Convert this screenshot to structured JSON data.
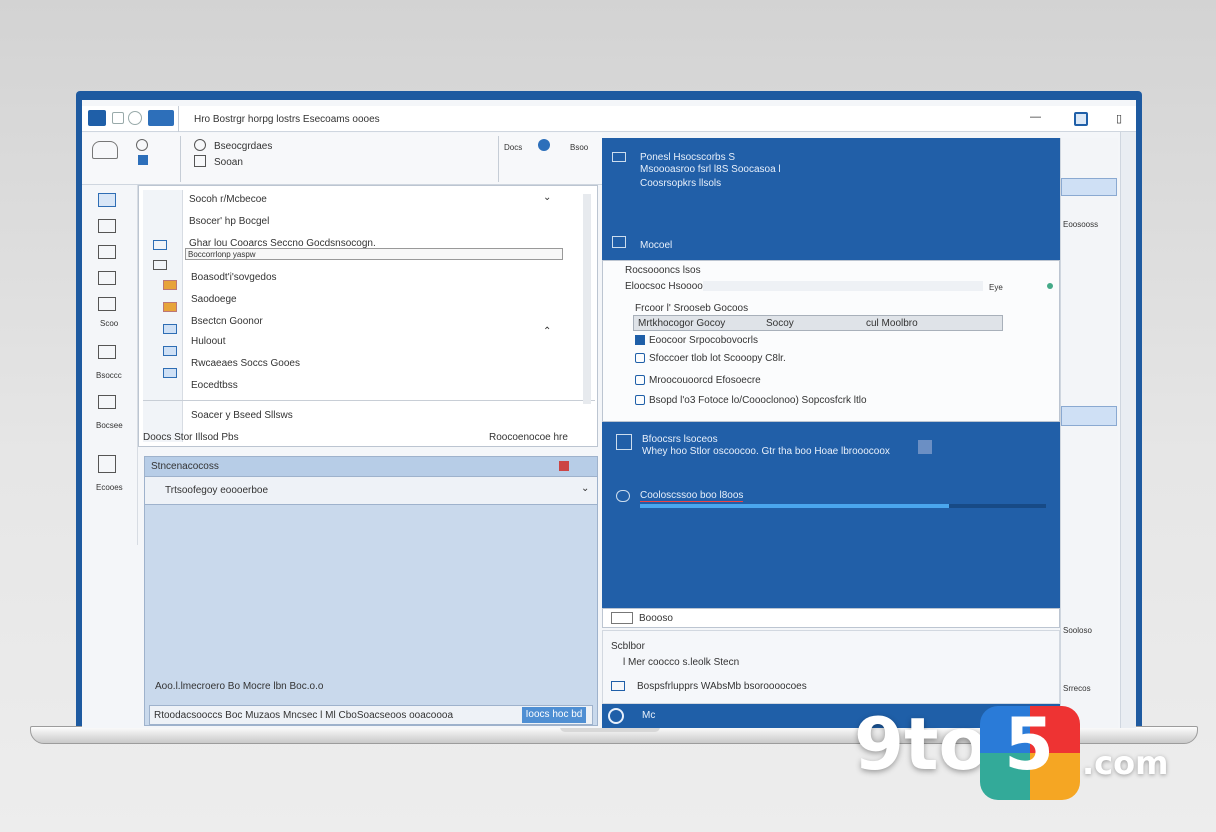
{
  "titlebar": {
    "title": "Hro Bostrgr horpg lostrs Esecoams oooes"
  },
  "ribbon": {
    "group1_a": "Bseocgrdaes",
    "group1_b": "Sooan",
    "tab_a": "Docs",
    "btn_a": "Bsoo"
  },
  "leftpanel": {
    "dropdown_label": "Socoh r/Mcbecoe",
    "row_selected": "Bsocer' hp Bocgel",
    "row_edit": "Ghar lou Cooarcs Seccno Gocdsnsocogn.",
    "row_edit_sub": "Boccorrlonp yaspw",
    "items": [
      "Boasodt'i'sovgedos",
      "Saodoege",
      "Bsectcn Goonor",
      "Huloout",
      "Rwcaeaes Soccs Gooes",
      "Eocedtbss"
    ],
    "footer_a": "Soacer y Bseed Sllsws",
    "footer_b": "Doocs Stor Illsod Pbs",
    "footer_c": "Roocoenocoe hre"
  },
  "sidebar_left": {
    "top_label": "Scoo",
    "items": [
      "Bsoccc",
      "Bocsee",
      "Ecooes"
    ]
  },
  "lower_left": {
    "title": "Stncenacocoss",
    "subtitle": "Trtsoofegoy eoooerboe",
    "status": "Aoo.l.lmecroero Bo Mocre lbn Boc.o.o",
    "footer_text": "Rtoodacsooccs Boc Muzaos Mncsec l Ml CboSoacseoos ooacoooa",
    "footer_button": "Ioocs hoc bd"
  },
  "right_blue_top": {
    "title": "Ponesl Hsocscorbs S",
    "subtitle": "Msoooasroo fsrl l8S Soocasoa l",
    "link": "Coosrsopkrs llsols",
    "bottom_label": "Mocoel"
  },
  "right_white_panel": {
    "header": "Rocsoooncs lsos",
    "field_label": "Eloocsoc Hsooooos",
    "field_value": "Eye",
    "search_label": "Frcoor l' Srooseb Gocoos",
    "table_row": [
      "Mrtkhocogor Gocoy",
      "Socoy",
      "cul Moolbro"
    ],
    "items": [
      "Eoocoor Srpocobovocrls",
      "Sfoccoer tlob lot Scooopy C8lr.",
      "Mroocouoorcd Efosoecre",
      "Bsopd l'o3 Fotoce lo/Coooclonoo) Sopcosfcrk ltlo"
    ]
  },
  "right_blue_bottom": {
    "title": "Bfoocsrs lsoceos",
    "subtitle": "Whey hoo Stlor oscoocoo. Gtr tha boo Hoae lbrooocoox",
    "progress_label": "Cooloscssoo boo l8oos",
    "progress": 0.76
  },
  "right_bottom": {
    "bar_label": "Boooso",
    "section": "Scblbor",
    "line1": "l Mer coocco s.leolk Stecn",
    "line2": "Bospsfrlupprs WAbsMb bsoroooocoes",
    "taskbar_label": "Mc"
  },
  "far_right": {
    "a": "Eoosooss",
    "b": "Sooloso",
    "c": "Srrecos"
  },
  "watermark": {
    "text_a": "9to",
    "text_b": "5",
    "text_c": ".com"
  }
}
